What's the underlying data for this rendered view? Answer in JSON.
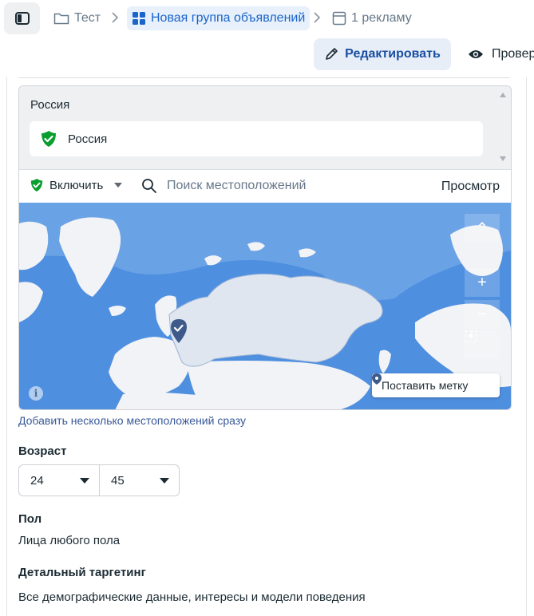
{
  "breadcrumb": {
    "campaign": "Тест",
    "adset": "Новая группа объявлений",
    "ads": "1 рекламу"
  },
  "actions": {
    "edit_label": "Редактировать",
    "preview_label": "Провер"
  },
  "locations": {
    "group_title": "Россия",
    "selected": [
      {
        "name": "Россия",
        "status": "included"
      }
    ],
    "include_label": "Включить",
    "search_placeholder": "Поиск местоположений",
    "view_label": "Просмотр",
    "drop_pin_label": "Поставить метку",
    "bulk_add_link": "Добавить несколько местоположений сразу"
  },
  "age": {
    "label": "Возраст",
    "min": "24",
    "max": "45"
  },
  "gender": {
    "label": "Пол",
    "value": "Лица любого пола"
  },
  "detailed_targeting": {
    "label": "Детальный таргетинг",
    "value": "Все демографические данные, интересы и модели поведения"
  },
  "colors": {
    "accent": "#1a65c9",
    "include_green": "#0a9e2f",
    "ocean": "#4f8fe0",
    "selected_region": "#dfe6f0"
  },
  "icons": {
    "sidebar_toggle": "sidebar-toggle-icon",
    "campaign": "folder-icon",
    "adset": "grid-icon",
    "ad": "ad-frame-icon",
    "edit": "pencil-icon",
    "preview": "eye-icon",
    "include": "green-check-shield-icon",
    "search": "search-icon",
    "map_pin": "map-pin-icon"
  }
}
